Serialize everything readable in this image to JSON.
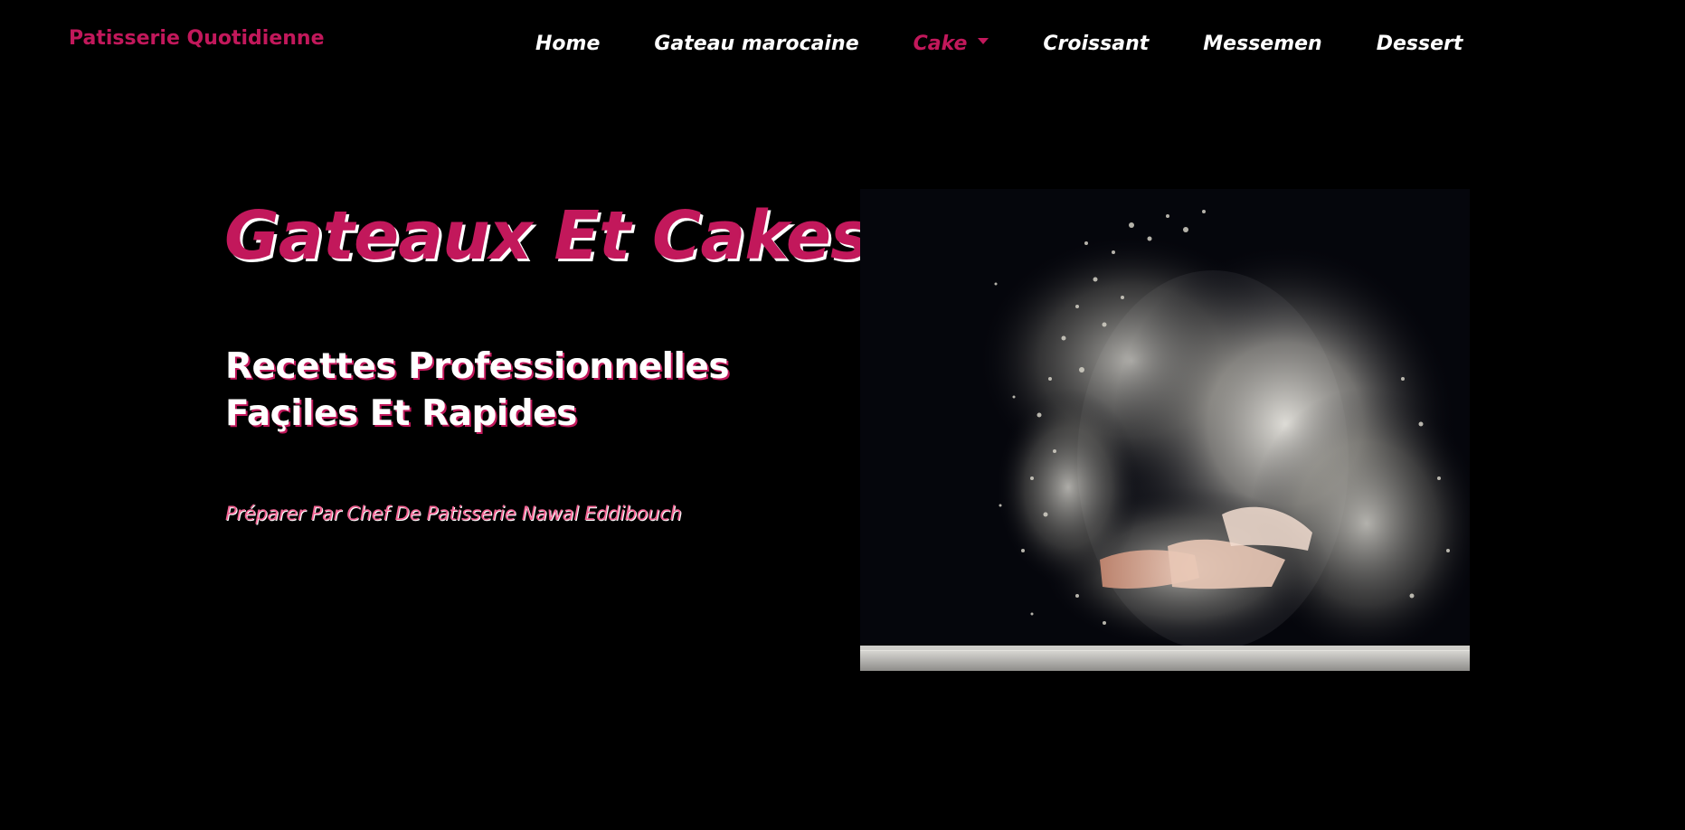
{
  "brand": {
    "name": "Patisserie Quotidienne",
    "color": "#c2185b"
  },
  "nav": {
    "items": [
      {
        "label": "Home",
        "active": false
      },
      {
        "label": "Gateau marocaine",
        "active": false
      },
      {
        "label": "Cake",
        "active": true,
        "dropdown": true
      },
      {
        "label": "Croissant",
        "active": false
      },
      {
        "label": "Messemen",
        "active": false
      },
      {
        "label": "Dessert",
        "active": false
      }
    ]
  },
  "hero": {
    "title": "Gateaux Et Cakes",
    "subtitle": "Recettes Professionnelles Façiles Et Rapides",
    "author": "Préparer Par Chef De Patisserie Nawal Eddibouch",
    "image_subject": "baker clapping hands in a cloud of flour"
  },
  "colors": {
    "background": "#000000",
    "accent": "#c2185b",
    "accent_light": "#f06292",
    "text": "#ffffff"
  }
}
